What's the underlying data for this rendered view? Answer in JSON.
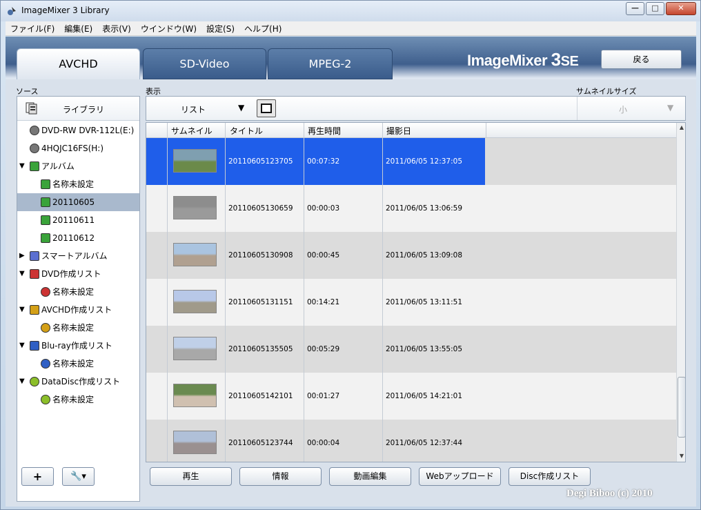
{
  "window": {
    "title": "ImageMixer 3 Library",
    "controls": {
      "minimize": "—",
      "maximize": "□",
      "close": "✕"
    }
  },
  "menu": [
    "ファイル(F)",
    "編集(E)",
    "表示(V)",
    "ウインドウ(W)",
    "設定(S)",
    "ヘルプ(H)"
  ],
  "tabs": [
    {
      "label": "AVCHD",
      "active": true
    },
    {
      "label": "SD-Video",
      "active": false
    },
    {
      "label": "MPEG-2",
      "active": false
    }
  ],
  "brand": {
    "main": "ImageMixer ",
    "num": "3",
    "suffix": "SE"
  },
  "back_label": "戻る",
  "labels": {
    "source": "ソース",
    "view": "表示",
    "thumb_size": "サムネイルサイズ"
  },
  "sidebar": {
    "library_label": "ライブラリ",
    "items": [
      {
        "label": "DVD-RW  DVR-112L(E:)",
        "icon": "disc-drive-icon",
        "level": 0,
        "arrow": ""
      },
      {
        "label": "4HQJC16FS(H:)",
        "icon": "drive-icon",
        "level": 0,
        "arrow": ""
      },
      {
        "label": "アルバム",
        "icon": "album-icon",
        "level": 0,
        "arrow": "▼"
      },
      {
        "label": "名称未設定",
        "icon": "film-icon",
        "level": 1,
        "arrow": ""
      },
      {
        "label": "20110605",
        "icon": "film-icon",
        "level": 1,
        "arrow": "",
        "selected": true
      },
      {
        "label": "20110611",
        "icon": "film-icon",
        "level": 1,
        "arrow": ""
      },
      {
        "label": "20110612",
        "icon": "film-icon",
        "level": 1,
        "arrow": ""
      },
      {
        "label": "スマートアルバム",
        "icon": "smart-album-icon",
        "level": 0,
        "arrow": "▶"
      },
      {
        "label": "DVD作成リスト",
        "icon": "dvd-list-icon",
        "level": 0,
        "arrow": "▼"
      },
      {
        "label": "名称未設定",
        "icon": "dvd-disc-icon",
        "level": 1,
        "arrow": ""
      },
      {
        "label": "AVCHD作成リスト",
        "icon": "avchd-list-icon",
        "level": 0,
        "arrow": "▼"
      },
      {
        "label": "名称未設定",
        "icon": "avchd-disc-icon",
        "level": 1,
        "arrow": ""
      },
      {
        "label": "Blu-ray作成リスト",
        "icon": "bluray-list-icon",
        "level": 0,
        "arrow": "▼"
      },
      {
        "label": "名称未設定",
        "icon": "bluray-disc-icon",
        "level": 1,
        "arrow": ""
      },
      {
        "label": "DataDisc作成リスト",
        "icon": "datadisc-list-icon",
        "level": 0,
        "arrow": "▼"
      },
      {
        "label": "名称未設定",
        "icon": "datadisc-disc-icon",
        "level": 1,
        "arrow": ""
      }
    ],
    "add_label": "+",
    "tool_label": "🔧▾"
  },
  "toolbar": {
    "view_value": "リスト",
    "thumb_size_value": "小"
  },
  "list": {
    "headers": {
      "thumbnail": "サムネイル",
      "title": "タイトル",
      "duration": "再生時間",
      "date": "撮影日"
    },
    "rows": [
      {
        "title": "20110605123705",
        "duration": "00:07:32",
        "date": "2011/06/05 12:37:05",
        "selected": true
      },
      {
        "title": "20110605130659",
        "duration": "00:00:03",
        "date": "2011/06/05 13:06:59"
      },
      {
        "title": "20110605130908",
        "duration": "00:00:45",
        "date": "2011/06/05 13:09:08"
      },
      {
        "title": "20110605131151",
        "duration": "00:14:21",
        "date": "2011/06/05 13:11:51"
      },
      {
        "title": "20110605135505",
        "duration": "00:05:29",
        "date": "2011/06/05 13:55:05"
      },
      {
        "title": "20110605142101",
        "duration": "00:01:27",
        "date": "2011/06/05 14:21:01"
      },
      {
        "title": "20110605123744",
        "duration": "00:00:04",
        "date": "2011/06/05 12:37:44"
      }
    ]
  },
  "actions": [
    "再生",
    "情報",
    "動画編集",
    "Webアップロード",
    "Disc作成リスト"
  ],
  "watermark": "Degi Biboo (c) 2010"
}
